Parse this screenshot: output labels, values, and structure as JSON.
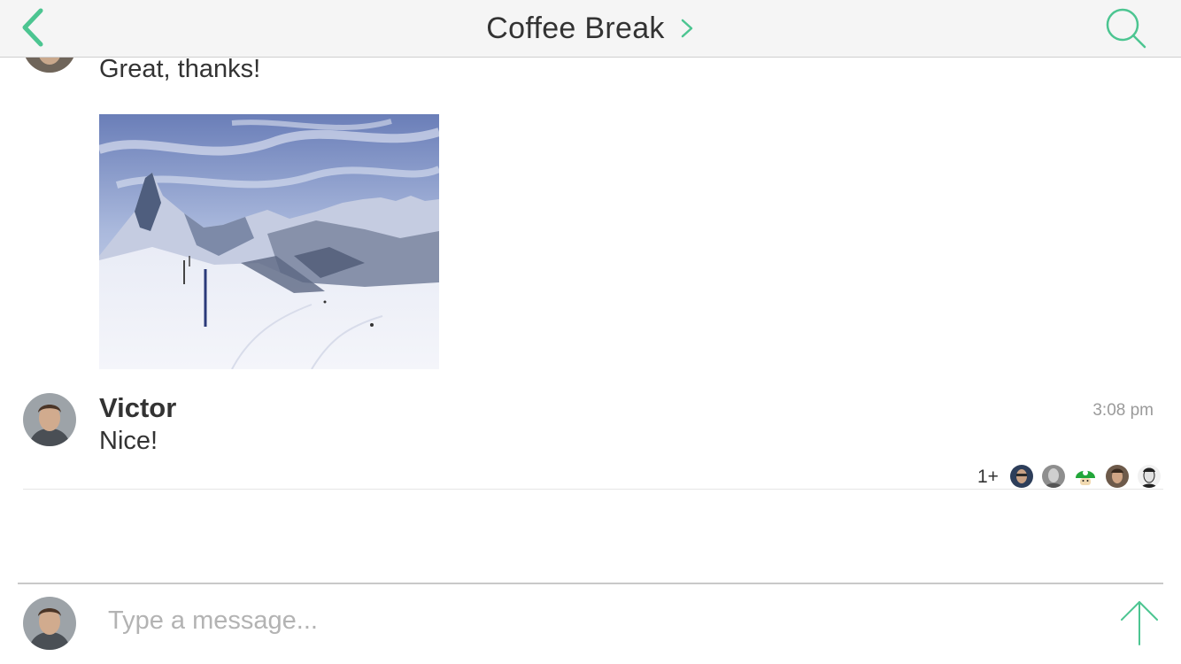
{
  "navbar": {
    "title": "Coffee Break",
    "back_icon": "chevron-left-icon",
    "title_icon": "chevron-right-icon",
    "search_icon": "search-icon"
  },
  "messages": [
    {
      "text": "Great, thanks!"
    },
    {
      "attachment": "photo",
      "subject": "snowy mountain peak"
    },
    {
      "sender": "Victor",
      "time": "3:08 pm",
      "text": "Nice!"
    }
  ],
  "read_receipts": {
    "count_label": "1+"
  },
  "composer": {
    "placeholder": "Type a message...",
    "send_icon": "arrow-up-icon"
  },
  "colors": {
    "accent": "#4cc591",
    "navbar_background": "#f5f5f5",
    "text": "#333333",
    "muted_text": "#9a9a9a",
    "placeholder": "#b3b3b3"
  }
}
